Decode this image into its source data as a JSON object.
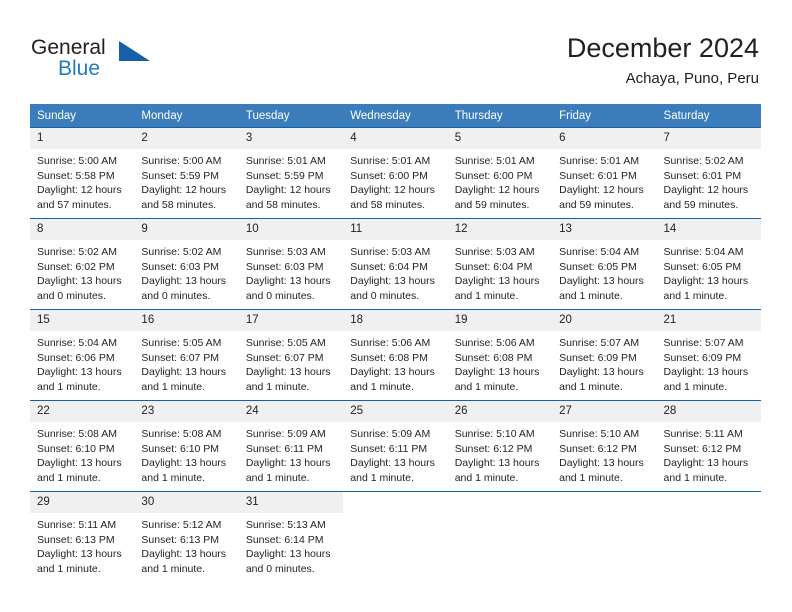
{
  "brand": {
    "name_part1": "General",
    "name_part2": "Blue",
    "flag_icon": "blue-triangle-flag-icon",
    "accent_color": "#1560a8",
    "blue_text_color": "#1e7bc4"
  },
  "header": {
    "title": "December 2024",
    "subtitle": "Achaya, Puno, Peru"
  },
  "calendar": {
    "header_bg": "#3b7cba",
    "daynum_bg": "#f0f0f0",
    "row_border_color": "#1560a8",
    "weekdays": [
      "Sunday",
      "Monday",
      "Tuesday",
      "Wednesday",
      "Thursday",
      "Friday",
      "Saturday"
    ],
    "weeks": [
      [
        {
          "day": "1",
          "sunrise": "Sunrise: 5:00 AM",
          "sunset": "Sunset: 5:58 PM",
          "daylight": "Daylight: 12 hours and 57 minutes."
        },
        {
          "day": "2",
          "sunrise": "Sunrise: 5:00 AM",
          "sunset": "Sunset: 5:59 PM",
          "daylight": "Daylight: 12 hours and 58 minutes."
        },
        {
          "day": "3",
          "sunrise": "Sunrise: 5:01 AM",
          "sunset": "Sunset: 5:59 PM",
          "daylight": "Daylight: 12 hours and 58 minutes."
        },
        {
          "day": "4",
          "sunrise": "Sunrise: 5:01 AM",
          "sunset": "Sunset: 6:00 PM",
          "daylight": "Daylight: 12 hours and 58 minutes."
        },
        {
          "day": "5",
          "sunrise": "Sunrise: 5:01 AM",
          "sunset": "Sunset: 6:00 PM",
          "daylight": "Daylight: 12 hours and 59 minutes."
        },
        {
          "day": "6",
          "sunrise": "Sunrise: 5:01 AM",
          "sunset": "Sunset: 6:01 PM",
          "daylight": "Daylight: 12 hours and 59 minutes."
        },
        {
          "day": "7",
          "sunrise": "Sunrise: 5:02 AM",
          "sunset": "Sunset: 6:01 PM",
          "daylight": "Daylight: 12 hours and 59 minutes."
        }
      ],
      [
        {
          "day": "8",
          "sunrise": "Sunrise: 5:02 AM",
          "sunset": "Sunset: 6:02 PM",
          "daylight": "Daylight: 13 hours and 0 minutes."
        },
        {
          "day": "9",
          "sunrise": "Sunrise: 5:02 AM",
          "sunset": "Sunset: 6:03 PM",
          "daylight": "Daylight: 13 hours and 0 minutes."
        },
        {
          "day": "10",
          "sunrise": "Sunrise: 5:03 AM",
          "sunset": "Sunset: 6:03 PM",
          "daylight": "Daylight: 13 hours and 0 minutes."
        },
        {
          "day": "11",
          "sunrise": "Sunrise: 5:03 AM",
          "sunset": "Sunset: 6:04 PM",
          "daylight": "Daylight: 13 hours and 0 minutes."
        },
        {
          "day": "12",
          "sunrise": "Sunrise: 5:03 AM",
          "sunset": "Sunset: 6:04 PM",
          "daylight": "Daylight: 13 hours and 1 minute."
        },
        {
          "day": "13",
          "sunrise": "Sunrise: 5:04 AM",
          "sunset": "Sunset: 6:05 PM",
          "daylight": "Daylight: 13 hours and 1 minute."
        },
        {
          "day": "14",
          "sunrise": "Sunrise: 5:04 AM",
          "sunset": "Sunset: 6:05 PM",
          "daylight": "Daylight: 13 hours and 1 minute."
        }
      ],
      [
        {
          "day": "15",
          "sunrise": "Sunrise: 5:04 AM",
          "sunset": "Sunset: 6:06 PM",
          "daylight": "Daylight: 13 hours and 1 minute."
        },
        {
          "day": "16",
          "sunrise": "Sunrise: 5:05 AM",
          "sunset": "Sunset: 6:07 PM",
          "daylight": "Daylight: 13 hours and 1 minute."
        },
        {
          "day": "17",
          "sunrise": "Sunrise: 5:05 AM",
          "sunset": "Sunset: 6:07 PM",
          "daylight": "Daylight: 13 hours and 1 minute."
        },
        {
          "day": "18",
          "sunrise": "Sunrise: 5:06 AM",
          "sunset": "Sunset: 6:08 PM",
          "daylight": "Daylight: 13 hours and 1 minute."
        },
        {
          "day": "19",
          "sunrise": "Sunrise: 5:06 AM",
          "sunset": "Sunset: 6:08 PM",
          "daylight": "Daylight: 13 hours and 1 minute."
        },
        {
          "day": "20",
          "sunrise": "Sunrise: 5:07 AM",
          "sunset": "Sunset: 6:09 PM",
          "daylight": "Daylight: 13 hours and 1 minute."
        },
        {
          "day": "21",
          "sunrise": "Sunrise: 5:07 AM",
          "sunset": "Sunset: 6:09 PM",
          "daylight": "Daylight: 13 hours and 1 minute."
        }
      ],
      [
        {
          "day": "22",
          "sunrise": "Sunrise: 5:08 AM",
          "sunset": "Sunset: 6:10 PM",
          "daylight": "Daylight: 13 hours and 1 minute."
        },
        {
          "day": "23",
          "sunrise": "Sunrise: 5:08 AM",
          "sunset": "Sunset: 6:10 PM",
          "daylight": "Daylight: 13 hours and 1 minute."
        },
        {
          "day": "24",
          "sunrise": "Sunrise: 5:09 AM",
          "sunset": "Sunset: 6:11 PM",
          "daylight": "Daylight: 13 hours and 1 minute."
        },
        {
          "day": "25",
          "sunrise": "Sunrise: 5:09 AM",
          "sunset": "Sunset: 6:11 PM",
          "daylight": "Daylight: 13 hours and 1 minute."
        },
        {
          "day": "26",
          "sunrise": "Sunrise: 5:10 AM",
          "sunset": "Sunset: 6:12 PM",
          "daylight": "Daylight: 13 hours and 1 minute."
        },
        {
          "day": "27",
          "sunrise": "Sunrise: 5:10 AM",
          "sunset": "Sunset: 6:12 PM",
          "daylight": "Daylight: 13 hours and 1 minute."
        },
        {
          "day": "28",
          "sunrise": "Sunrise: 5:11 AM",
          "sunset": "Sunset: 6:12 PM",
          "daylight": "Daylight: 13 hours and 1 minute."
        }
      ],
      [
        {
          "day": "29",
          "sunrise": "Sunrise: 5:11 AM",
          "sunset": "Sunset: 6:13 PM",
          "daylight": "Daylight: 13 hours and 1 minute."
        },
        {
          "day": "30",
          "sunrise": "Sunrise: 5:12 AM",
          "sunset": "Sunset: 6:13 PM",
          "daylight": "Daylight: 13 hours and 1 minute."
        },
        {
          "day": "31",
          "sunrise": "Sunrise: 5:13 AM",
          "sunset": "Sunset: 6:14 PM",
          "daylight": "Daylight: 13 hours and 0 minutes."
        },
        {
          "day": "",
          "sunrise": "",
          "sunset": "",
          "daylight": ""
        },
        {
          "day": "",
          "sunrise": "",
          "sunset": "",
          "daylight": ""
        },
        {
          "day": "",
          "sunrise": "",
          "sunset": "",
          "daylight": ""
        },
        {
          "day": "",
          "sunrise": "",
          "sunset": "",
          "daylight": ""
        }
      ]
    ]
  }
}
